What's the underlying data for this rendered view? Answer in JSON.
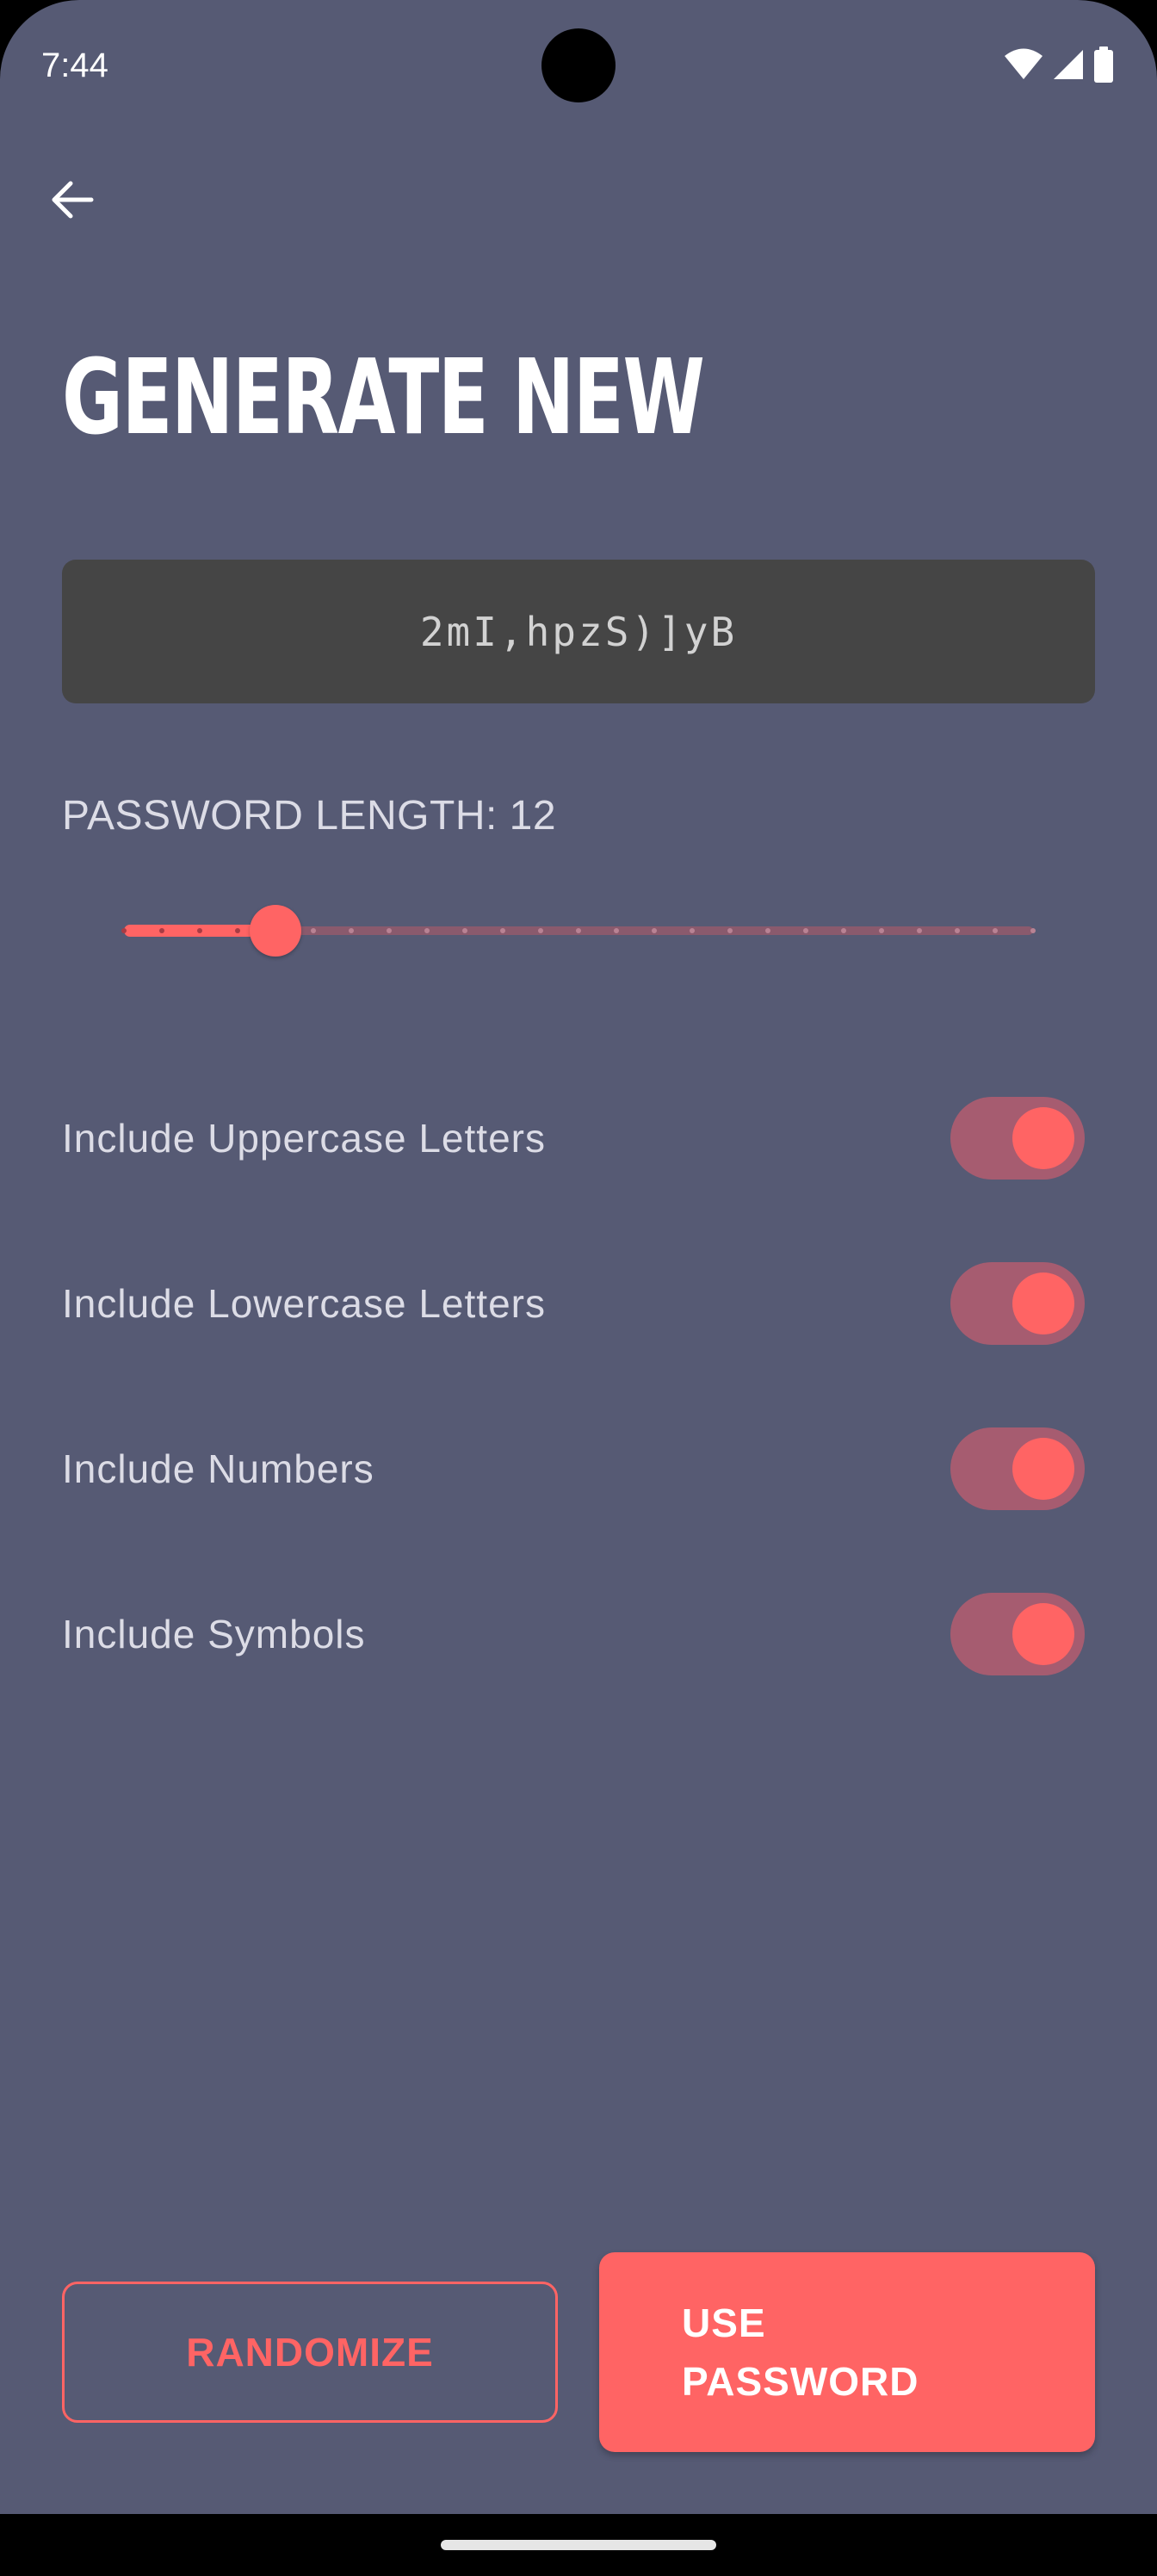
{
  "status_bar": {
    "time": "7:44",
    "icons": [
      "wifi-icon",
      "cellular-signal-icon",
      "battery-icon"
    ]
  },
  "header": {
    "back_icon": "arrow-left-icon",
    "title": "GENERATE NEW"
  },
  "generated_password": "2mI,hpzS)]yB",
  "length": {
    "label": "PASSWORD LENGTH: 12",
    "value": 12,
    "min": 8,
    "max": 32
  },
  "options": [
    {
      "label": "Include Uppercase Letters",
      "enabled": true
    },
    {
      "label": "Include Lowercase Letters",
      "enabled": true
    },
    {
      "label": "Include Numbers",
      "enabled": true
    },
    {
      "label": "Include Symbols",
      "enabled": true
    }
  ],
  "actions": {
    "randomize_label": "RANDOMIZE",
    "use_password_label": "USE PASSWORD"
  },
  "colors": {
    "background": "#565a74",
    "accent": "#ff6464",
    "password_box": "#454545",
    "toggle_track": "#a65c70",
    "slider_inactive": "#8a5a6d"
  }
}
